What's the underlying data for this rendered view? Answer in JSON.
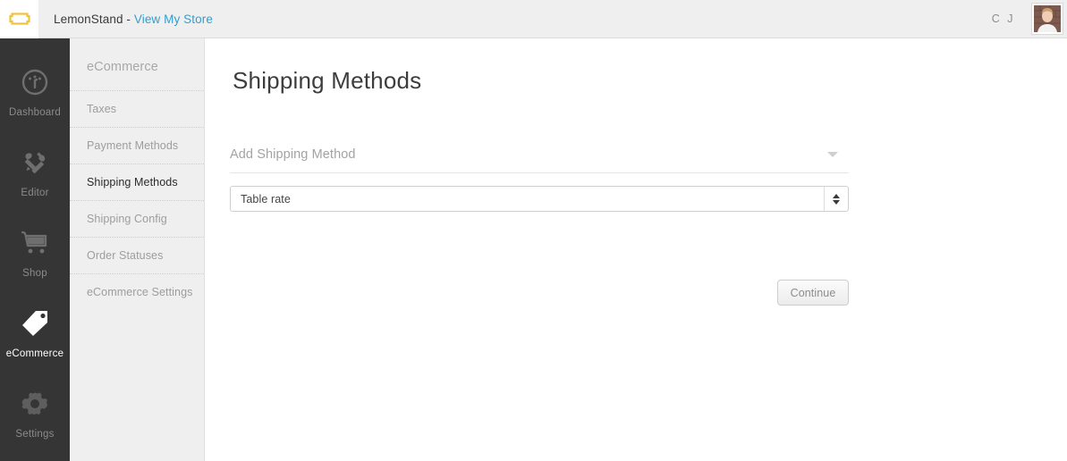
{
  "header": {
    "logo_icon": "lemonstand-tag-logo",
    "brand_text": "LemonStand - ",
    "store_link_label": "View My Store",
    "user_initials": "C J",
    "avatar_icon": "user-avatar-photo"
  },
  "primary_nav": {
    "items": [
      {
        "label": "Dashboard",
        "icon": "gauge-icon",
        "active": false
      },
      {
        "label": "Editor",
        "icon": "wrench-pencil-icon",
        "active": false
      },
      {
        "label": "Shop",
        "icon": "shopping-cart-icon",
        "active": false
      },
      {
        "label": "eCommerce",
        "icon": "price-tag-icon",
        "active": true
      },
      {
        "label": "Settings",
        "icon": "gear-icon",
        "active": false
      }
    ]
  },
  "secondary_nav": {
    "title": "eCommerce",
    "items": [
      {
        "label": "Taxes",
        "active": false
      },
      {
        "label": "Payment Methods",
        "active": false
      },
      {
        "label": "Shipping Methods",
        "active": true
      },
      {
        "label": "Shipping Config",
        "active": false
      },
      {
        "label": "Order Statuses",
        "active": false
      },
      {
        "label": "eCommerce Settings",
        "active": false
      }
    ]
  },
  "main": {
    "page_title": "Shipping Methods",
    "add_method_label": "Add Shipping Method",
    "add_method_caret_icon": "chevron-down-icon",
    "shipping_method_select": {
      "value": "Table rate",
      "stepper_icon": "up-down-stepper-icon"
    },
    "continue_label": "Continue"
  },
  "colors": {
    "primary_nav_bg": "#353535",
    "secondary_nav_bg": "#efefef",
    "header_bg": "#efefef",
    "link": "#2f9fd0",
    "logo_yellow": "#f0c33c",
    "active_text": "#2b2b2b",
    "muted_text": "#9d9d9d"
  }
}
